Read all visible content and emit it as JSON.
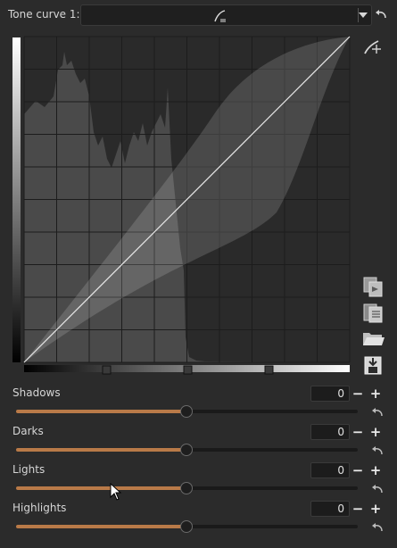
{
  "header": {
    "curve_label": "Tone curve 1:"
  },
  "curve_type_select": {
    "icon": "curve-type-icon"
  },
  "curve_area": {
    "gradient_stops": [
      "shadows-handle",
      "midtones-handle",
      "highlights-handle"
    ]
  },
  "side_tools": [
    "edit-points-icon",
    "copy-icon",
    "paste-icon",
    "open-icon",
    "save-icon"
  ],
  "sliders": [
    {
      "label": "Shadows",
      "value": "0",
      "level": 0.5
    },
    {
      "label": "Darks",
      "value": "0",
      "level": 0.5
    },
    {
      "label": "Lights",
      "value": "0",
      "level": 0.5
    },
    {
      "label": "Highlights",
      "value": "0",
      "level": 0.5
    }
  ],
  "colors": {
    "accent": "#b97a48",
    "background": "#2b2b2b",
    "graph_background": "#2a2a2a"
  }
}
